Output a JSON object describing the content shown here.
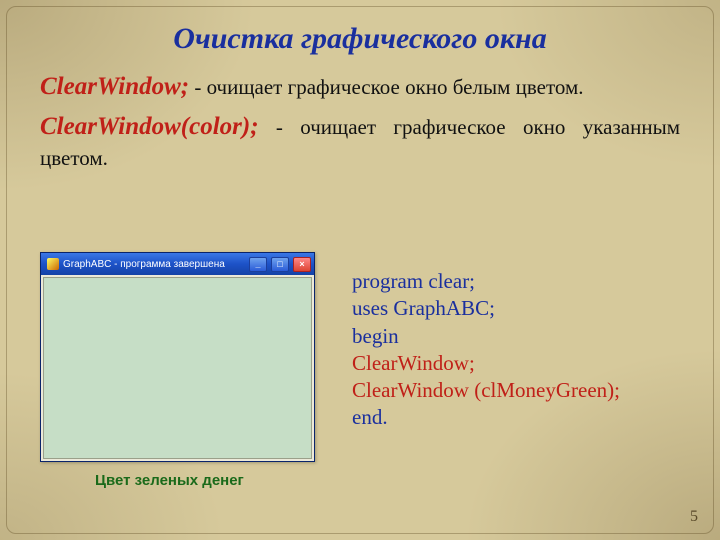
{
  "title": "Очистка графического окна",
  "p1": {
    "cmd": "ClearWindow;",
    "rest": " - очищает графическое окно белым цветом."
  },
  "p2": {
    "cmd": "ClearWindow(color);",
    "rest": " - очищает графическое окно указанным цветом."
  },
  "window": {
    "title": "GraphABC - программа завершена",
    "min": "_",
    "max": "□",
    "close": "×"
  },
  "caption": "Цвет зеленых денег",
  "code": {
    "l1": "program clear;",
    "l2": "uses GraphABC;",
    "l3": "begin",
    "l4": "ClearWindow;",
    "l5": "ClearWindow (clMoneyGreen);",
    "l6": "end."
  },
  "pagenum": "5"
}
